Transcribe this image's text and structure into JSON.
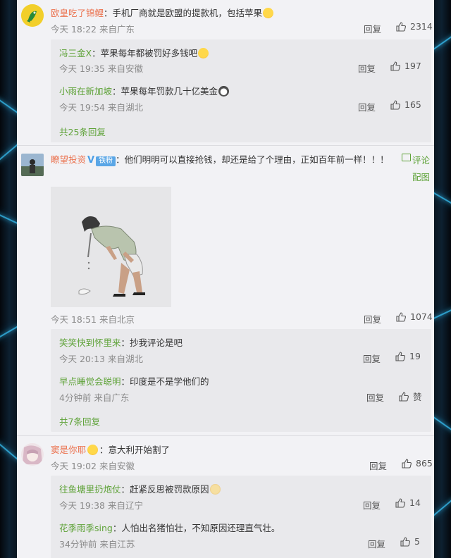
{
  "comments": [
    {
      "user": "欧皇吃了锦鲤",
      "text": "手机厂商就是欧盟的提款机，包括苹果",
      "time": "今天 18:22 来自广东",
      "reply": "回复",
      "likes": "2314",
      "sub": [
        {
          "user": "冯三金X",
          "text": "苹果每年都被罚好多钱吧",
          "time": "今天 19:35 来自安徽",
          "reply": "回复",
          "likes": "197"
        },
        {
          "user": "小雨在新加坡",
          "text": "苹果每年罚款几十亿美金",
          "time": "今天 19:54 来自湖北",
          "reply": "回复",
          "likes": "165"
        }
      ],
      "more": "共25条回复"
    },
    {
      "user": "瞭望投资",
      "fan_badge": "铁粉",
      "text": "他们明明可以直接抢钱，却还是给了个理由，正如百年前一样！！！",
      "pic_link": "评论配图",
      "time": "今天 18:51 来自北京",
      "reply": "回复",
      "likes": "1074",
      "sub": [
        {
          "user": "笑笑快到怀里来",
          "text": "抄我评论是吧",
          "time": "今天 20:13 来自湖北",
          "reply": "回复",
          "likes": "19"
        },
        {
          "user": "早点睡觉会聪明",
          "text": "印度是不是学他们的",
          "time": "4分钟前 来自广东",
          "reply": "回复",
          "likes": "赞"
        }
      ],
      "more": "共7条回复"
    },
    {
      "user": "窦是你耶",
      "text": "意大利开始割了",
      "time": "今天 19:02 来自安徽",
      "reply": "回复",
      "likes": "865",
      "sub": [
        {
          "user": "往鱼塘里扔炮仗",
          "text": "赶紧反思被罚款原因",
          "time": "今天 19:38 来自辽宁",
          "reply": "回复",
          "likes": "14"
        },
        {
          "user": "花季雨季sing",
          "text": "人怕出名猪怕壮，不知原因还理直气壮。",
          "time": "34分钟前 来自江苏",
          "reply": "回复",
          "likes": "5"
        }
      ]
    }
  ]
}
